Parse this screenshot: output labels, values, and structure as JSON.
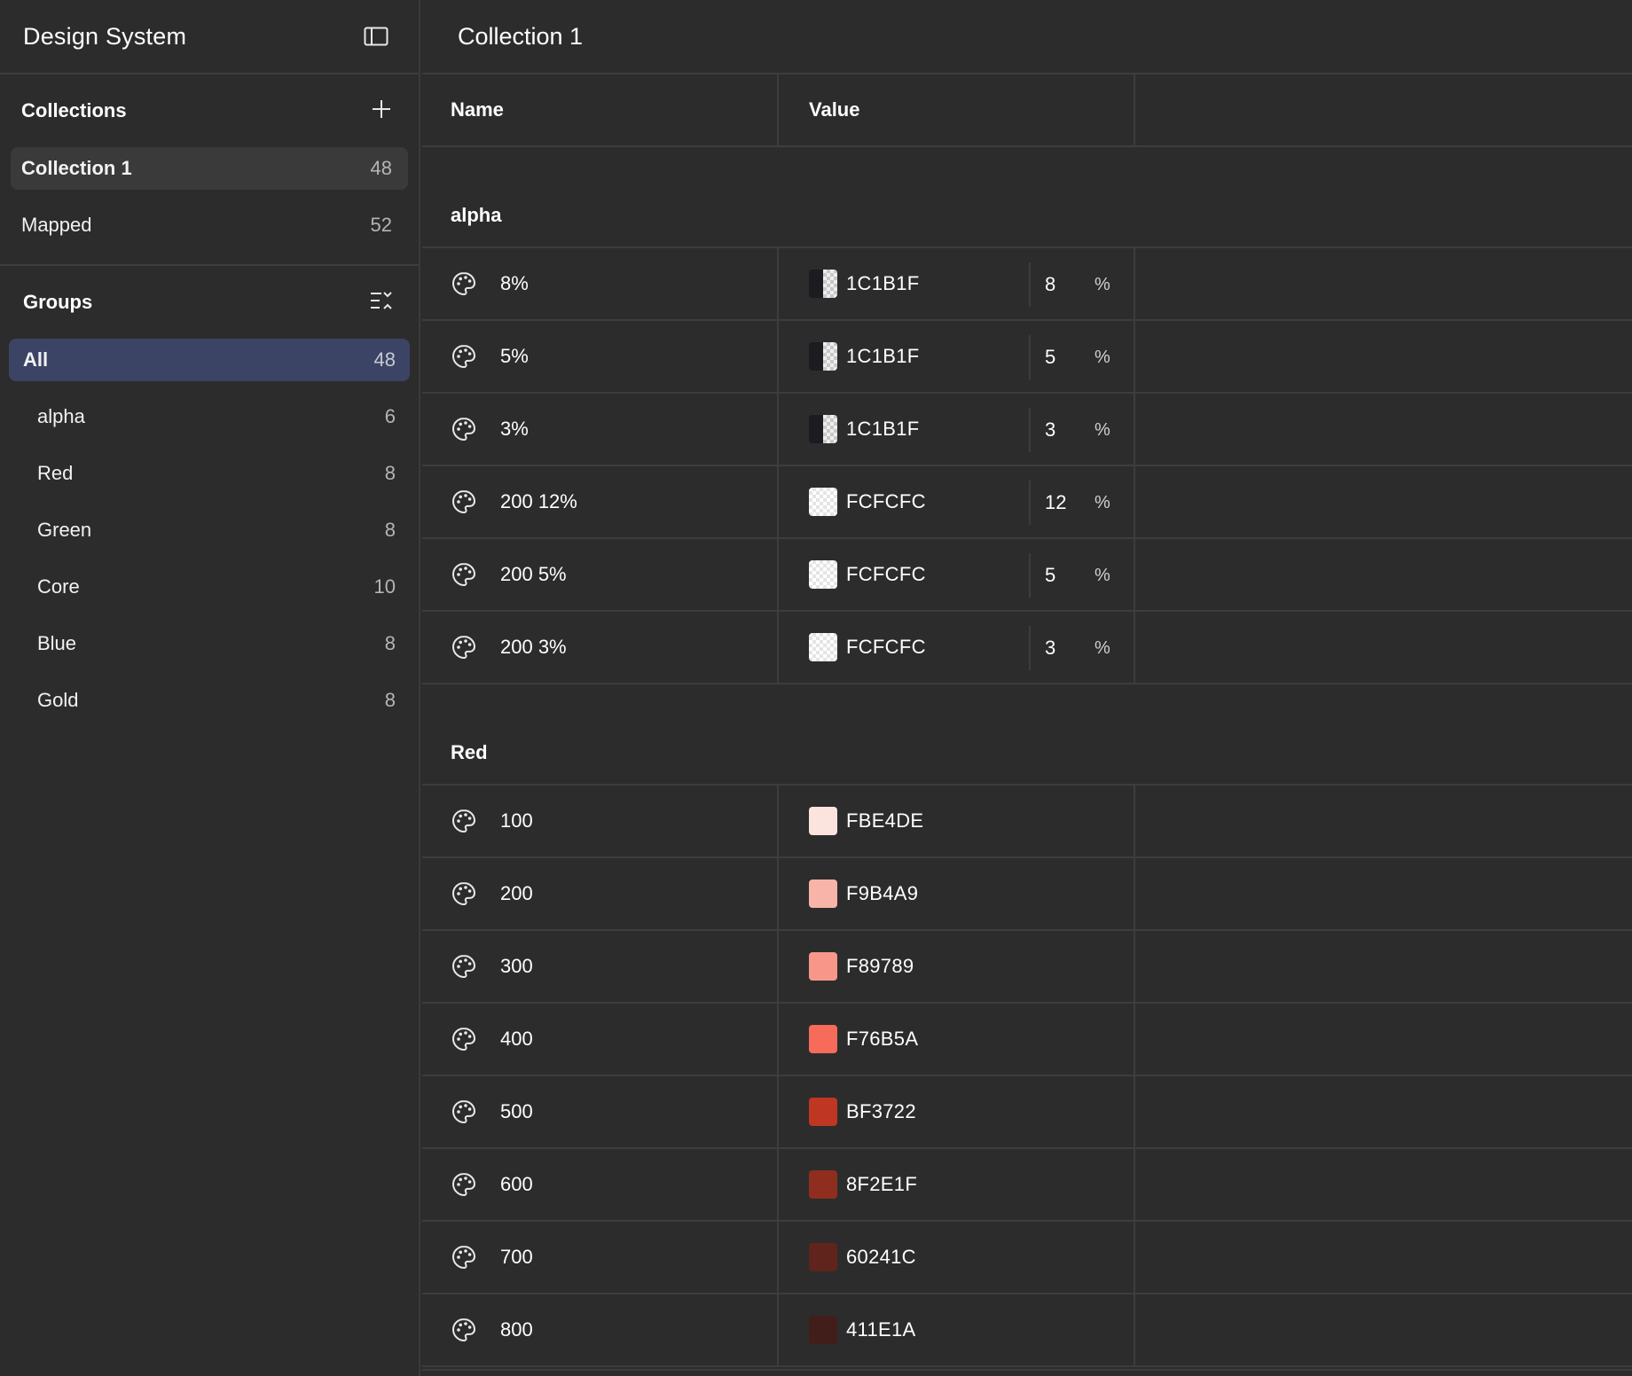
{
  "app": {
    "title": "Design System"
  },
  "collections": {
    "title": "Collections",
    "items": [
      {
        "label": "Collection 1",
        "count": "48",
        "selected": true
      },
      {
        "label": "Mapped",
        "count": "52",
        "selected": false
      }
    ]
  },
  "groups": {
    "title": "Groups",
    "items": [
      {
        "label": "All",
        "count": "48",
        "active": true
      },
      {
        "label": "alpha",
        "count": "6"
      },
      {
        "label": "Red",
        "count": "8"
      },
      {
        "label": "Green",
        "count": "8"
      },
      {
        "label": "Core",
        "count": "10"
      },
      {
        "label": "Blue",
        "count": "8"
      },
      {
        "label": "Gold",
        "count": "8"
      }
    ]
  },
  "main": {
    "title": "Collection 1",
    "columns": {
      "name": "Name",
      "value": "Value"
    },
    "sections": [
      {
        "name": "alpha",
        "rows": [
          {
            "name": "8%",
            "hex": "1C1B1F",
            "alpha": "8",
            "unit": "%",
            "swatch": "alpha-dark"
          },
          {
            "name": "5%",
            "hex": "1C1B1F",
            "alpha": "5",
            "unit": "%",
            "swatch": "alpha-dark"
          },
          {
            "name": "3%",
            "hex": "1C1B1F",
            "alpha": "3",
            "unit": "%",
            "swatch": "alpha-dark"
          },
          {
            "name": "200 12%",
            "hex": "FCFCFC",
            "alpha": "12",
            "unit": "%",
            "swatch": "alpha-light"
          },
          {
            "name": "200 5%",
            "hex": "FCFCFC",
            "alpha": "5",
            "unit": "%",
            "swatch": "alpha-light"
          },
          {
            "name": "200 3%",
            "hex": "FCFCFC",
            "alpha": "3",
            "unit": "%",
            "swatch": "alpha-light"
          }
        ]
      },
      {
        "name": "Red",
        "rows": [
          {
            "name": "100",
            "hex": "FBE4DE",
            "color": "#FBE4DE"
          },
          {
            "name": "200",
            "hex": "F9B4A9",
            "color": "#F9B4A9"
          },
          {
            "name": "300",
            "hex": "F89789",
            "color": "#F89789"
          },
          {
            "name": "400",
            "hex": "F76B5A",
            "color": "#F76B5A"
          },
          {
            "name": "500",
            "hex": "BF3722",
            "color": "#BF3722"
          },
          {
            "name": "600",
            "hex": "8F2E1F",
            "color": "#8F2E1F"
          },
          {
            "name": "700",
            "hex": "60241C",
            "color": "#60241C"
          },
          {
            "name": "800",
            "hex": "411E1A",
            "color": "#411E1A"
          }
        ]
      }
    ]
  }
}
